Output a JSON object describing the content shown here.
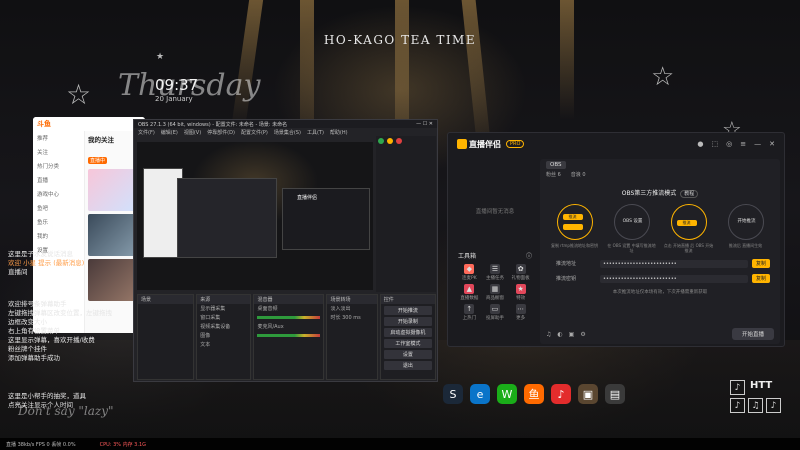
{
  "wallpaper": {
    "title": "HO-KAGO TEA TIME",
    "time": "09:37",
    "date": "20 January",
    "script_text": "Thursday",
    "quote": "Don't say \"lazy\"",
    "logo": {
      "label": "HTT"
    }
  },
  "chat_overlay": {
    "block1": [
      "这里是子水友说话消息",
      "欢迎 小星 提示 (最新消息)",
      "直播间"
    ],
    "block2": [
      "欢迎排号条弹幕助手",
      "左键拖拽弹幕区改变位置，左键拖拽",
      "边框改变大小",
      "右上角有设置菜单",
      "这里显示弹幕，喜欢开播/收费",
      "粉丝牌个挂件",
      "添加弹幕助手成功"
    ],
    "block3": [
      "这里是小帮手的抽奖，道具",
      "点亮关注显示个人时间"
    ]
  },
  "status_bar": {
    "left": "直播 38kb/s FPS 0 丢帧 0.0%",
    "mid": "CPU: 3% 内存 3.1G",
    "mid_color": "#ff5a5a"
  },
  "dock": {
    "icons": [
      {
        "name": "steam-icon",
        "glyph": "S",
        "color": "#1b2838"
      },
      {
        "name": "edge-icon",
        "glyph": "e",
        "color": "#0a74c9"
      },
      {
        "name": "wechat-icon",
        "glyph": "W",
        "color": "#1aad19"
      },
      {
        "name": "app-orange-icon",
        "glyph": "鱼",
        "color": "#ff6a00"
      },
      {
        "name": "netease-music-icon",
        "glyph": "♪",
        "color": "#e32c2c"
      },
      {
        "name": "app-game-icon",
        "glyph": "▣",
        "color": "#5a4630"
      },
      {
        "name": "app-drive-icon",
        "glyph": "▤",
        "color": "#3a3a3a"
      }
    ]
  },
  "client": {
    "logo": "斗鱼",
    "nav": [
      "推荐",
      "关注",
      "热门分类",
      "直播",
      "游戏中心",
      "鱼吧",
      "鱼乐",
      "我的",
      "设置"
    ],
    "section": "我的关注",
    "live_tag": "直播中"
  },
  "obs": {
    "title": "OBS 27.1.3 (64 bit, windows) - 配置文件: 未命名 - 场景: 未命名",
    "menu": [
      "文件(F)",
      "编辑(E)",
      "视图(V)",
      "停靠部件(D)",
      "配置文件(P)",
      "场景集合(S)",
      "工具(T)",
      "帮助(H)"
    ],
    "preview_label": "直播伴侣",
    "scenes_title": "场景",
    "sources_title": "来源",
    "mixer_title": "混音器",
    "transitions_title": "场景转场",
    "controls_title": "控件",
    "controls": [
      "开始推流",
      "开始录制",
      "启动虚拟摄像机",
      "工作室模式",
      "设置",
      "退出"
    ],
    "mixer_tracks": [
      "桌面音频",
      "麦克风/Aux"
    ],
    "transition_value": "淡入淡出",
    "duration_label": "时长",
    "duration_value": "300 ms",
    "sources": [
      "显示器采集",
      "窗口采集",
      "视频采集设备",
      "图像",
      "文本"
    ]
  },
  "companion": {
    "logo": "直播伴侣",
    "badge": "PRO",
    "tab": "OBS",
    "stat1": "粉丝 6",
    "stat2": "音浪 0",
    "chat_empty": "直播间暂无消息",
    "tools_title": "工具箱",
    "tools": [
      "连麦PK",
      "主播任务",
      "礼物面板",
      "直播数据",
      "商品橱窗",
      "特效",
      "上热门",
      "投屏助手",
      "更多"
    ],
    "step_title": "OBS第三方推流模式",
    "step_pill": "教程",
    "steps": [
      {
        "chip": "推流",
        "text": "",
        "cap": "复制 rtmp推流地址和密钥"
      },
      {
        "chip": "",
        "text": "OBS 设置",
        "cap": "在 OBS 设置 中填写推流地址"
      },
      {
        "chip": "推流",
        "text": "",
        "cap": "点击 开始直播 后 OBS 开始推流"
      },
      {
        "chip": "",
        "text": "开始推流",
        "cap": "推流后 直播间生效"
      }
    ],
    "fields": [
      {
        "label": "推流地址",
        "value": "•••••••••••••••••••••••••",
        "button": "复制"
      },
      {
        "label": "推流密钥",
        "value": "•••••••••••••••••••••••••",
        "button": "复制"
      }
    ],
    "tip": "本次推流地址仅本场有效，下次开播需重新获取",
    "go_live": "开始直播",
    "accent": "#ffb400"
  }
}
